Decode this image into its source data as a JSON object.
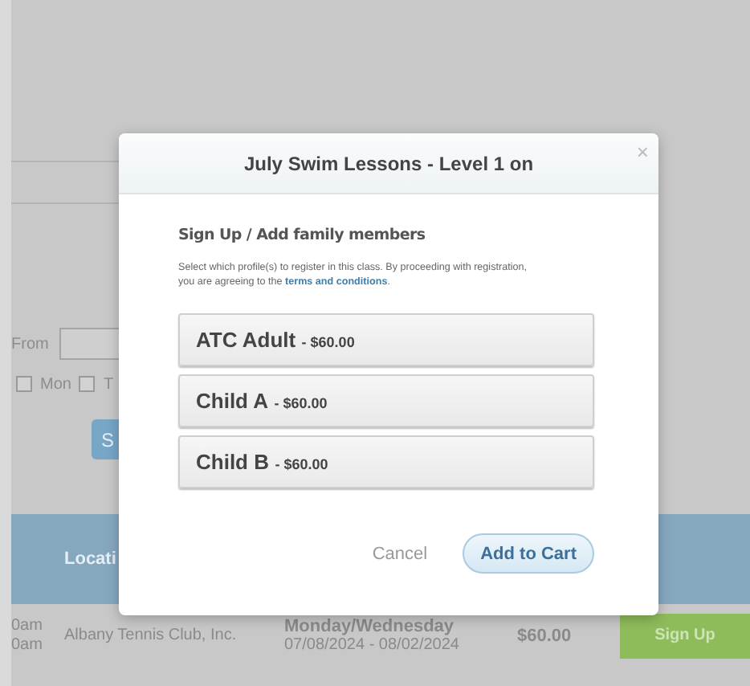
{
  "background": {
    "date_filter": {
      "label": "From"
    },
    "day_options": [
      {
        "label": "Mon",
        "checked": false
      },
      {
        "label": "T",
        "checked": false
      }
    ],
    "search_button": "S",
    "table_header": [
      "Locati"
    ],
    "rows": [
      {
        "time_start": "0am",
        "time_end": "0am",
        "location": "Albany Tennis Club, Inc.",
        "days": "Monday/Wednesday",
        "dates": "07/08/2024 - 08/02/2024",
        "price": "$60.00",
        "action": "Sign Up"
      }
    ]
  },
  "modal": {
    "title": "July Swim Lessons - Level 1 on",
    "close": "×",
    "heading": "Sign Up / Add family members",
    "description": {
      "text": "Select which profile(s) to register in this class. By proceeding with registration, you are agreeing to the ",
      "link": "terms and conditions",
      "after": "."
    },
    "profiles": [
      {
        "name": "ATC Adult",
        "price": "- $60.00"
      },
      {
        "name": "Child A",
        "price": "- $60.00"
      },
      {
        "name": "Child B",
        "price": "- $60.00"
      }
    ],
    "cancel": "Cancel",
    "confirm": "Add to Cart"
  }
}
